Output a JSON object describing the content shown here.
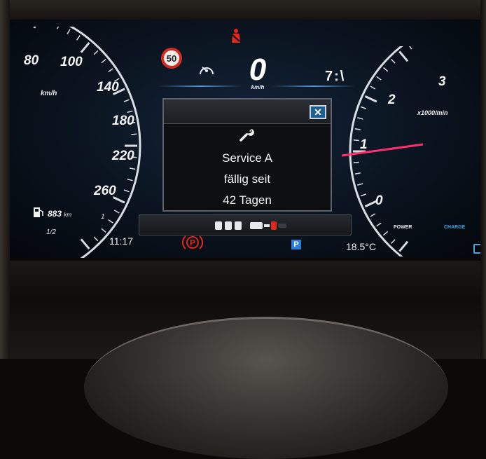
{
  "speedometer": {
    "labels": [
      "80",
      "100",
      "140",
      "180",
      "220",
      "260"
    ],
    "unit": "km/h"
  },
  "top_bar": {
    "speed_limit": "50",
    "current_speed": "0",
    "speed_unit": "km/h",
    "gear_indicator": "7:\\"
  },
  "service_message": {
    "close_symbol": "✕",
    "line1": "Service A",
    "line2": "fällig seit",
    "line3": "42 Tagen"
  },
  "fuel": {
    "range_value": "883",
    "range_unit": "km",
    "half_mark": "1/2",
    "full_mark": "1"
  },
  "bottom_bar": {
    "time": "11:17",
    "parking_brake_symbol": "P",
    "park_assist_symbol": "P",
    "outside_temp": "18.5°C"
  },
  "tachometer": {
    "labels": [
      "0",
      "1",
      "2",
      "3"
    ],
    "unit": "x1000/min",
    "power_label": "POWER",
    "charge_label": "CHARGE"
  },
  "colors": {
    "needle": "#ff2e6e",
    "accent_blue": "#4a93dd",
    "warning_red": "#e0281c"
  },
  "icons": [
    "seatbelt-warning-icon",
    "cruise-control-icon",
    "wrench-icon",
    "parking-brake-icon",
    "fuel-pump-icon",
    "driver-assist-icon",
    "park-assist-icon"
  ]
}
